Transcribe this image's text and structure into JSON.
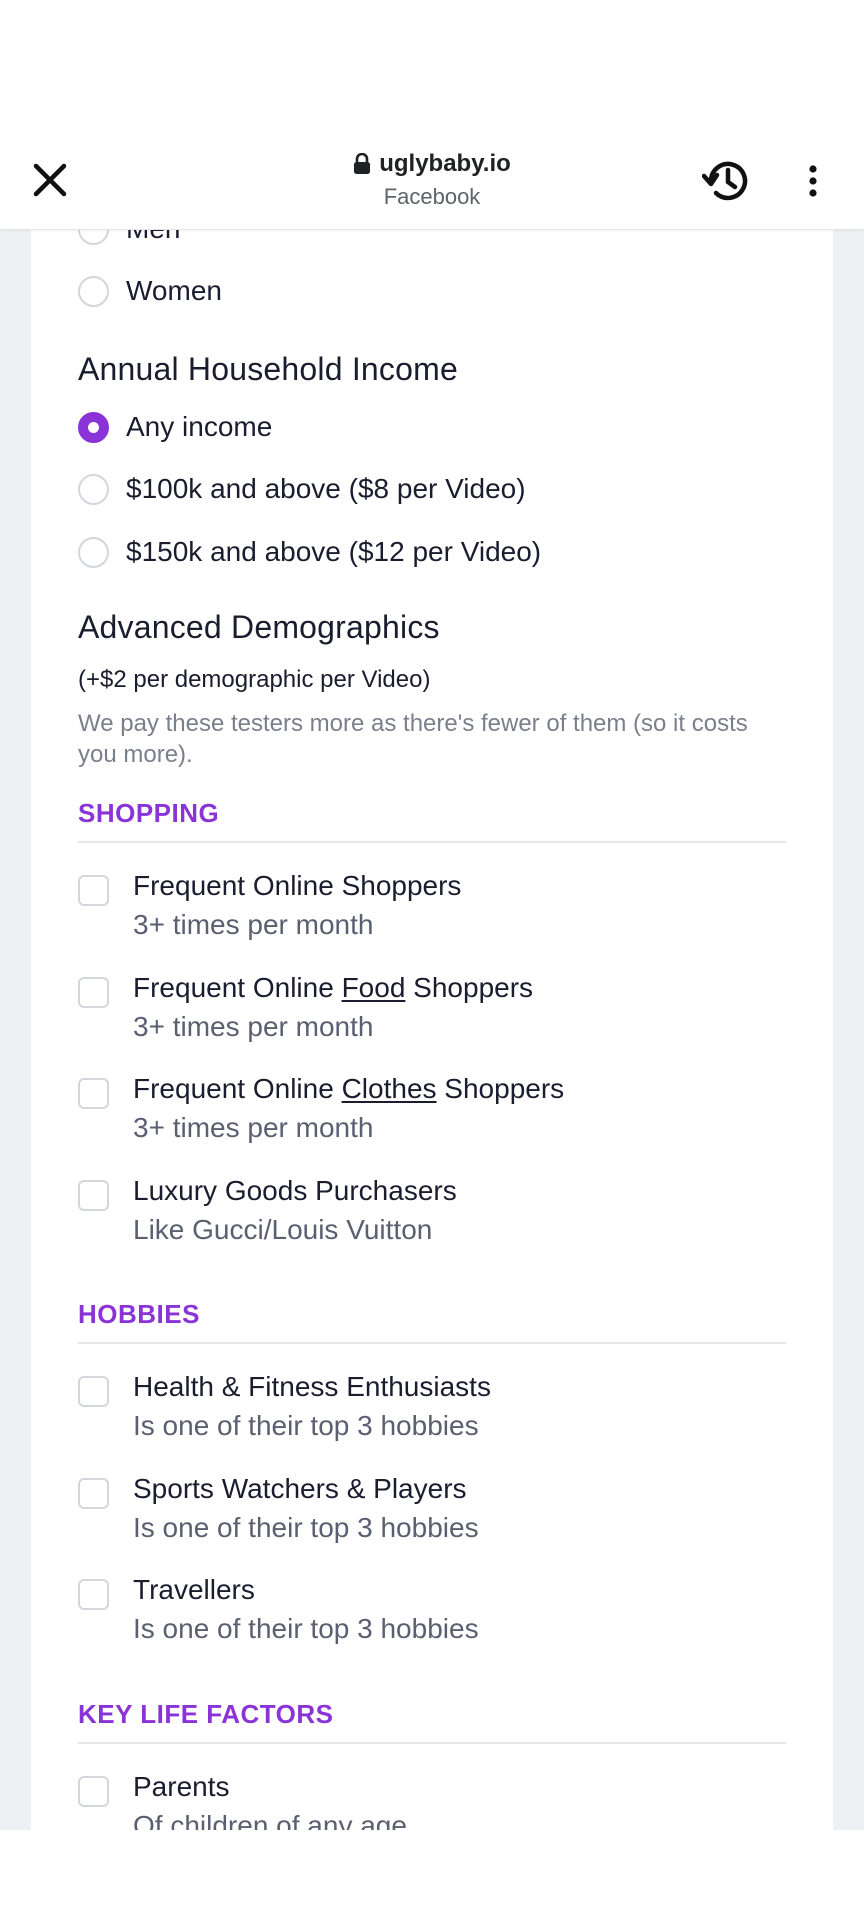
{
  "browser": {
    "url": "uglybaby.io",
    "subtitle": "Facebook",
    "close_icon": "close-icon",
    "lock_icon": "lock-icon",
    "history_icon": "history-icon",
    "menu_icon": "more-vert-icon"
  },
  "gender": {
    "options": [
      {
        "label": "Men",
        "checked": false
      },
      {
        "label": "Women",
        "checked": false
      }
    ]
  },
  "income": {
    "title": "Annual Household Income",
    "options": [
      {
        "label": "Any income",
        "checked": true
      },
      {
        "label": "$100k and above ($8 per Video)",
        "checked": false
      },
      {
        "label": "$150k and above ($12 per Video)",
        "checked": false
      }
    ]
  },
  "advanced": {
    "title": "Advanced Demographics",
    "price_note": "(+$2 per demographic per Video)",
    "description": "We pay these testers more as there's fewer of them (so it costs you more)."
  },
  "sections": [
    {
      "title": "SHOPPING",
      "items": [
        {
          "pre": "Frequent Online Shoppers",
          "underline": "",
          "post": "",
          "sub": "3+ times per month"
        },
        {
          "pre": "Frequent Online ",
          "underline": "Food",
          "post": " Shoppers",
          "sub": "3+ times per month"
        },
        {
          "pre": "Frequent Online ",
          "underline": "Clothes",
          "post": " Shoppers",
          "sub": "3+ times per month"
        },
        {
          "pre": "Luxury Goods Purchasers",
          "underline": "",
          "post": "",
          "sub": "Like Gucci/Louis Vuitton"
        }
      ]
    },
    {
      "title": "HOBBIES",
      "items": [
        {
          "pre": "Health & Fitness Enthusiasts",
          "underline": "",
          "post": "",
          "sub": "Is one of their top 3 hobbies"
        },
        {
          "pre": "Sports Watchers & Players",
          "underline": "",
          "post": "",
          "sub": "Is one of their top 3 hobbies"
        },
        {
          "pre": "Travellers",
          "underline": "",
          "post": "",
          "sub": "Is one of their top 3 hobbies"
        }
      ]
    },
    {
      "title": "KEY LIFE FACTORS",
      "items": [
        {
          "pre": "Parents",
          "underline": "",
          "post": "",
          "sub": "Of children of any age"
        }
      ]
    }
  ],
  "colors": {
    "accent": "#8a33d6",
    "text": "#1a1d2e",
    "muted": "#7a7f8c",
    "page_bg": "#eef0f3"
  }
}
